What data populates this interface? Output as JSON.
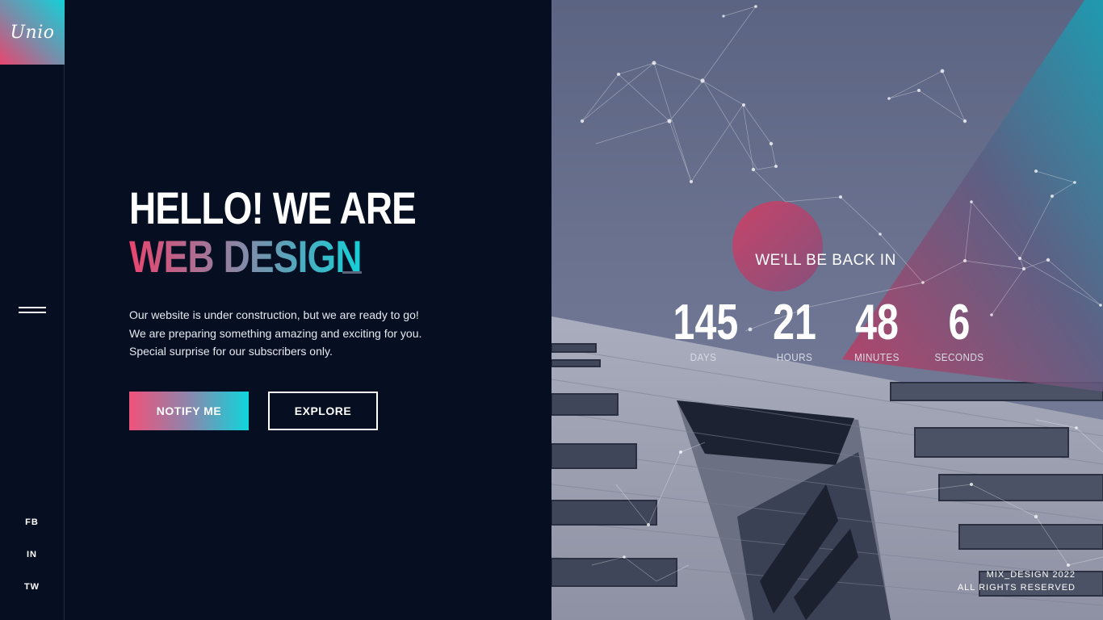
{
  "brand": {
    "logo_text": "Unio"
  },
  "social": [
    {
      "label": "FB"
    },
    {
      "label": "IN"
    },
    {
      "label": "TW"
    }
  ],
  "hero": {
    "title_line1": "HELLO! WE ARE",
    "title_line2": "WEB DESIGN",
    "description": [
      "Our website is under construction, but we are ready to go!",
      "We are preparing something amazing and exciting for you.",
      "Special surprise for our subscribers only."
    ],
    "primary_button": "NOTIFY ME",
    "secondary_button": "EXPLORE"
  },
  "countdown": {
    "title": "WE'LL BE BACK IN",
    "days": {
      "value": "145",
      "label": "DAYS"
    },
    "hours": {
      "value": "21",
      "label": "HOURS"
    },
    "minutes": {
      "value": "48",
      "label": "MINUTES"
    },
    "seconds": {
      "value": "6",
      "label": "SECONDS"
    }
  },
  "footer": {
    "line1": "MIX_DESIGN 2022",
    "line2": "ALL RIGHTS RESERVED"
  },
  "colors": {
    "background": "#060f22",
    "accent_pink": "#e9456f",
    "accent_cyan": "#14d0d8"
  },
  "icons": {
    "menu": "hamburger-menu-icon"
  }
}
